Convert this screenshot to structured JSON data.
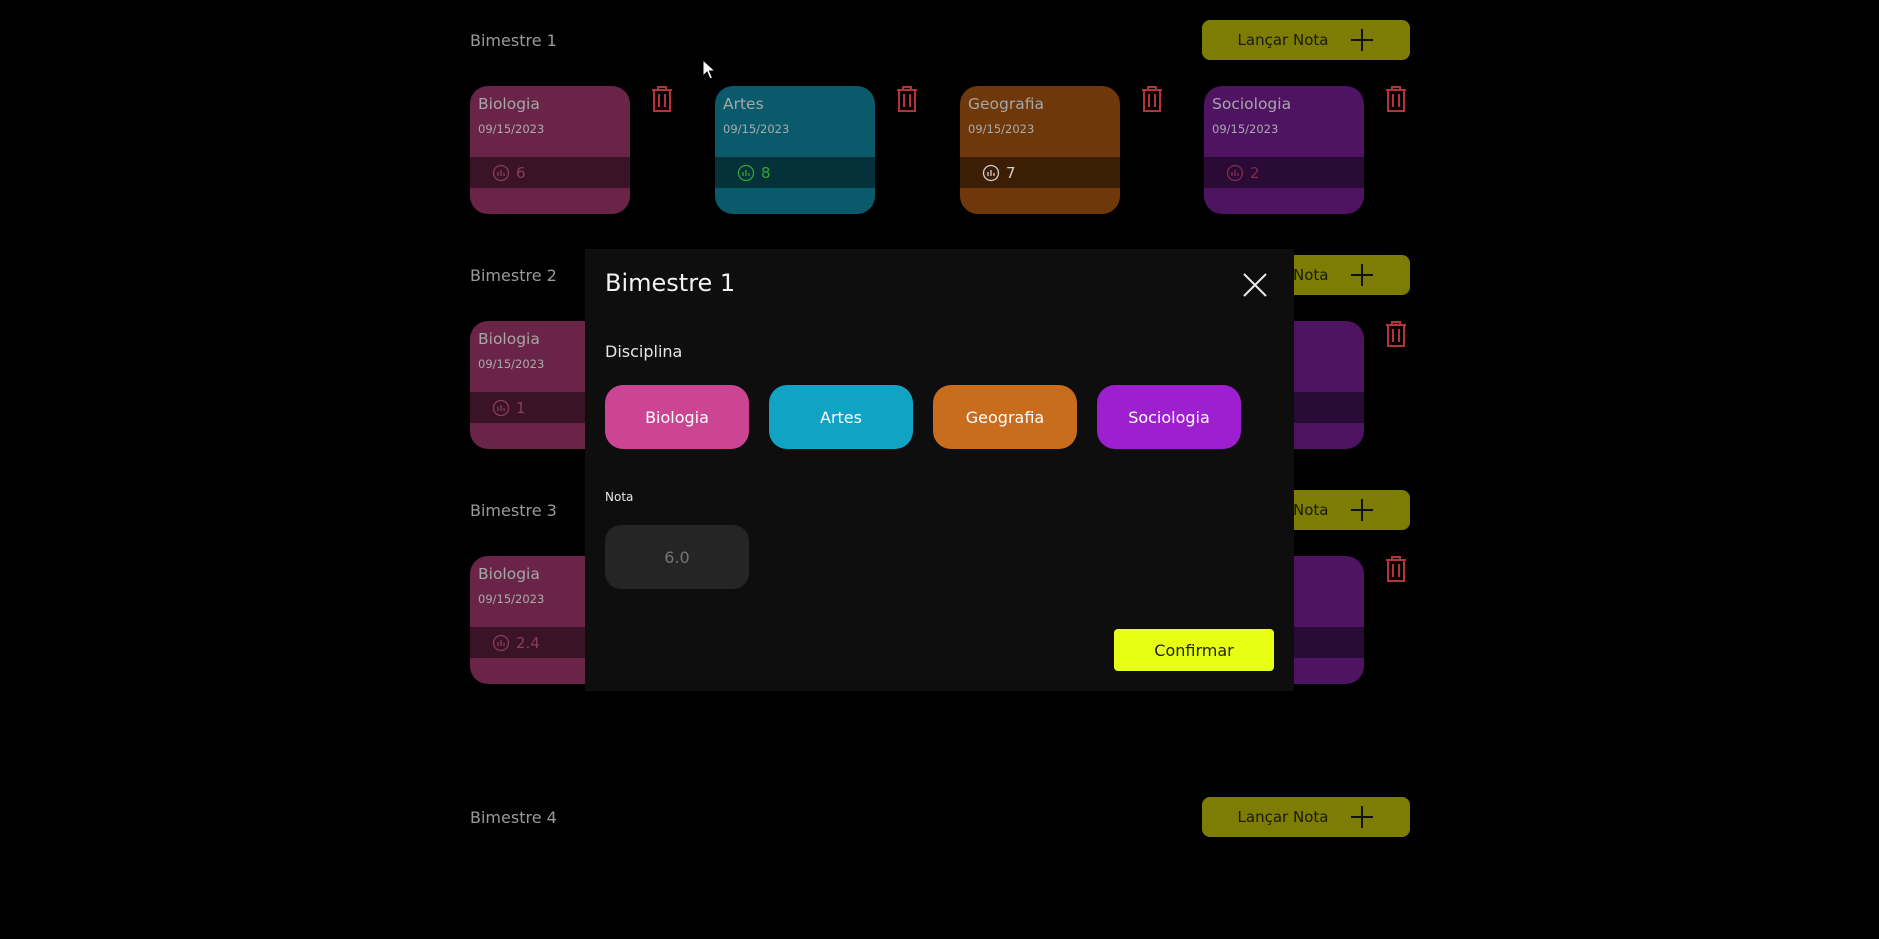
{
  "sections": [
    {
      "title": "Bimestre 1",
      "add_label": "Lançar Nota",
      "cards": [
        {
          "name": "Biologia",
          "date": "09/15/2023",
          "grade": "6",
          "color": "#6a2448",
          "grade_color": "#8a3c5e"
        },
        {
          "name": "Artes",
          "date": "09/15/2023",
          "grade": "8",
          "color": "#0a5a6c",
          "grade_color": "#2ea82e"
        },
        {
          "name": "Geografia",
          "date": "09/15/2023",
          "grade": "7",
          "color": "#6e380a",
          "grade_color": "#cfcfcf"
        },
        {
          "name": "Sociologia",
          "date": "09/15/2023",
          "grade": "2",
          "color": "#4e1462",
          "grade_color": "#8a2a50"
        }
      ]
    },
    {
      "title": "Bimestre 2",
      "add_label": "Lançar Nota",
      "cards": [
        {
          "name": "Biologia",
          "date": "09/15/2023",
          "grade": "1",
          "color": "#6a2448",
          "grade_color": "#8a3c5e"
        }
      ]
    },
    {
      "title": "Bimestre 3",
      "add_label": "Lançar Nota",
      "cards": [
        {
          "name": "Biologia",
          "date": "09/15/2023",
          "grade": "2.4",
          "color": "#6a2448",
          "grade_color": "#8a3c5e"
        }
      ]
    },
    {
      "title": "Bimestre 4",
      "add_label": "Lançar Nota",
      "cards": []
    }
  ],
  "modal": {
    "title": "Bimestre 1",
    "discipline_label": "Disciplina",
    "subjects": [
      {
        "label": "Biologia",
        "color": "#cc4592"
      },
      {
        "label": "Artes",
        "color": "#10a3c4"
      },
      {
        "label": "Geografia",
        "color": "#c86c1e"
      },
      {
        "label": "Sociologia",
        "color": "#9e1fcf"
      }
    ],
    "grade_label": "Nota",
    "grade_placeholder": "6.0",
    "confirm_label": "Confirmar"
  },
  "colors": {
    "accent": "#e6ff12",
    "add_button": "#7d7d05",
    "trash": "#b8323a"
  }
}
